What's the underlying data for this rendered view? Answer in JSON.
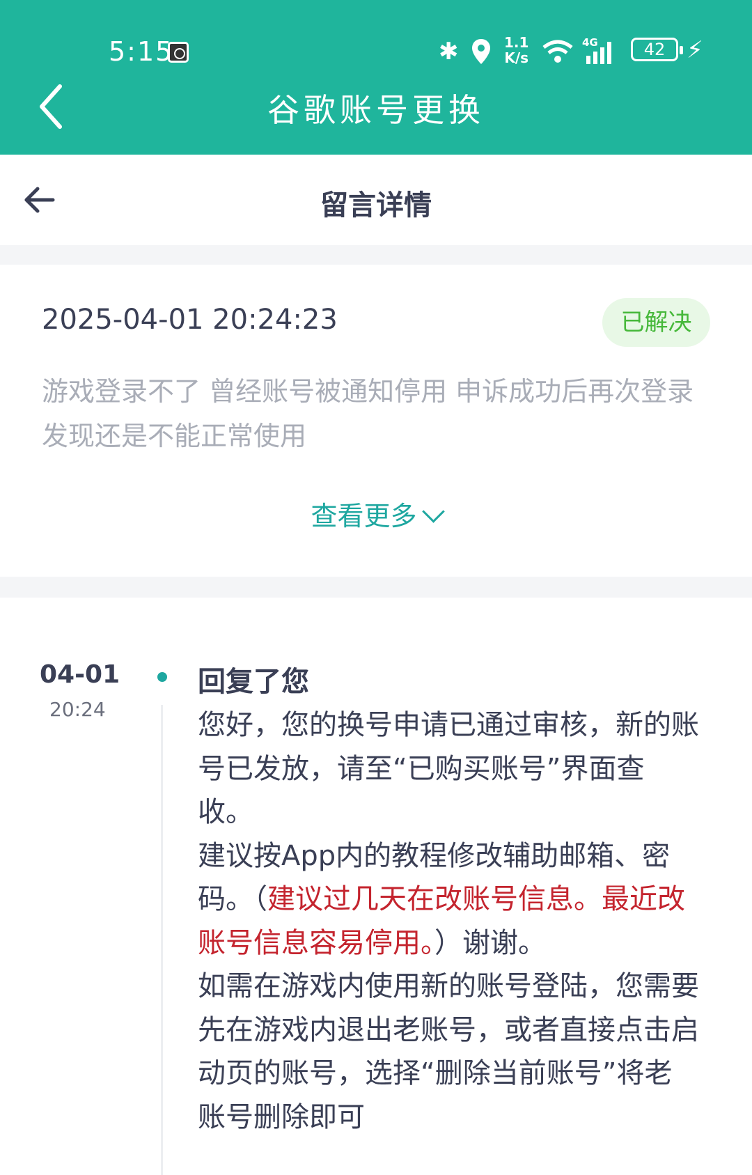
{
  "status_bar": {
    "time": "5:15",
    "speed": "1.1\nK/s",
    "network": "4G",
    "battery": "42"
  },
  "app_bar": {
    "title": "谷歌账号更换"
  },
  "sub_header": {
    "title": "留言详情"
  },
  "message": {
    "datetime": "2025-04-01 20:24:23",
    "status_badge": "已解决",
    "content": "游戏登录不了 曾经账号被通知停用 申诉成功后再次登录 发现还是不能正常使用",
    "view_more": "查看更多"
  },
  "reply": {
    "date": "04-01",
    "time": "20:24",
    "heading": "回复了您",
    "line1": "您好，您的换号申请已通过审核，新的账号已发放，请至“已购买账号”界面查收。",
    "line2_a": "建议按App内的教程修改辅助邮箱、密码。（",
    "line2_red": "建议过几天在改账号信息。最近改账号信息容易停用。",
    "line2_b": "）谢谢。",
    "line3": "如需在游戏内使用新的账号登陆，您需要先在游戏内退出老账号，或者直接点击启动页的账号，选择“删除当前账号”将老账号删除即可"
  },
  "colors": {
    "app_bar": "#1fb59c",
    "accent": "#1ea7a0",
    "badge_text": "#46b83a",
    "badge_bg": "#e8f8e6",
    "highlight_red": "#c4242e"
  }
}
